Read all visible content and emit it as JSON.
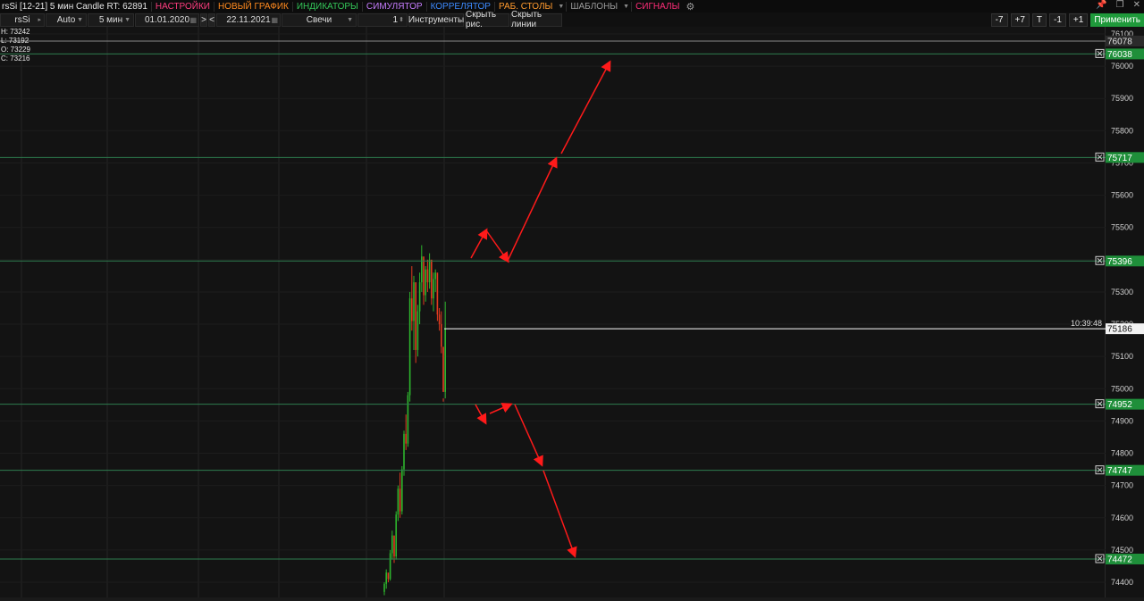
{
  "menubar": {
    "title": "rsSi [12-21] 5 мин Candle RT: 62891",
    "items": [
      {
        "label": "НАСТРОЙКИ",
        "color": "#ff3d7f"
      },
      {
        "label": "НОВЫЙ ГРАФИК",
        "color": "#ff8a1f"
      },
      {
        "label": "ИНДИКАТОРЫ",
        "color": "#34c759"
      },
      {
        "label": "СИМУЛЯТОР",
        "color": "#c77dff"
      },
      {
        "label": "КОРРЕЛЯТОР",
        "color": "#3d8bff"
      },
      {
        "label": "РАБ. СТОЛЫ",
        "color": "#ff9a2e"
      },
      {
        "label": "ШАБЛОНЫ",
        "color": "#9a9a9a"
      },
      {
        "label": "СИГНАЛЫ",
        "color": "#ff2d78"
      }
    ]
  },
  "toolbar": {
    "symbol": "rsSi",
    "scale": "Auto",
    "timeframe": "5 мин",
    "date_from": "01.01.2020",
    "date_to": "22.11.2021",
    "nav_next": ">",
    "nav_prev": "<",
    "chart_type": "Свечи",
    "count": "1",
    "instruments": "Инструменты",
    "hide_drawings": "Скрыть рис.",
    "hide_lines": "Скрыть линии",
    "btn_m7": "-7",
    "btn_p7": "+7",
    "btn_t": "T",
    "btn_m1": "-1",
    "btn_p1": "+1",
    "apply": "Применить"
  },
  "ohlc": {
    "h": "H: 73242",
    "l": "L: 73192",
    "o": "O: 73229",
    "c": "C: 73216"
  },
  "colors": {
    "level_line": "#2e7d4f",
    "level_badge": "#1f8f3a",
    "current_line": "#ffffff",
    "arrow": "#ff1a1a",
    "candle_up": "#2db52d",
    "candle_down": "#e23b1f",
    "grid": "#242424"
  },
  "chart_data": {
    "type": "candlestick",
    "y_ticks": [
      76100,
      76000,
      75900,
      75800,
      75700,
      75600,
      75500,
      75400,
      75300,
      75200,
      75100,
      75000,
      74900,
      74800,
      74700,
      74600,
      74500,
      74400
    ],
    "ylim": [
      74355,
      76125
    ],
    "levels": [
      {
        "value": 76078,
        "label": "76078",
        "style": "grey"
      },
      {
        "value": 76038,
        "label": "76038",
        "style": "green"
      },
      {
        "value": 75717,
        "label": "75717",
        "style": "green"
      },
      {
        "value": 75396,
        "label": "75396",
        "style": "green"
      },
      {
        "value": 74952,
        "label": "74952",
        "style": "green"
      },
      {
        "value": 74747,
        "label": "74747",
        "style": "green"
      },
      {
        "value": 74472,
        "label": "74472",
        "style": "green"
      }
    ],
    "current_price": {
      "value": 75186,
      "label": "75186",
      "time": "10:39:48"
    },
    "candles": [
      [
        74370,
        74400,
        74360,
        74395
      ],
      [
        74395,
        74440,
        74380,
        74430
      ],
      [
        74430,
        74420,
        74400,
        74410
      ],
      [
        74410,
        74500,
        74405,
        74490
      ],
      [
        74490,
        74560,
        74470,
        74545
      ],
      [
        74545,
        74530,
        74460,
        74480
      ],
      [
        74480,
        74620,
        74470,
        74610
      ],
      [
        74610,
        74700,
        74590,
        74690
      ],
      [
        74690,
        74740,
        74600,
        74620
      ],
      [
        74620,
        74760,
        74610,
        74750
      ],
      [
        74750,
        74870,
        74730,
        74860
      ],
      [
        74860,
        74920,
        74810,
        74830
      ],
      [
        74830,
        74990,
        74820,
        74980
      ],
      [
        74980,
        75300,
        74960,
        75280
      ],
      [
        75280,
        75380,
        75180,
        75210
      ],
      [
        75210,
        75350,
        75120,
        75330
      ],
      [
        75330,
        75230,
        75080,
        75120
      ],
      [
        75120,
        75260,
        75100,
        75240
      ],
      [
        75240,
        75360,
        75200,
        75330
      ],
      [
        75330,
        75445,
        75300,
        75410
      ],
      [
        75410,
        75320,
        75260,
        75290
      ],
      [
        75290,
        75380,
        75270,
        75370
      ],
      [
        75370,
        75400,
        75300,
        75330
      ],
      [
        75330,
        75420,
        75310,
        75400
      ],
      [
        75400,
        75340,
        75260,
        75280
      ],
      [
        75280,
        75360,
        75240,
        75340
      ],
      [
        75340,
        75370,
        75300,
        75360
      ],
      [
        75360,
        75320,
        75210,
        75230
      ],
      [
        75230,
        75250,
        75180,
        75200
      ],
      [
        75200,
        75240,
        75110,
        75130
      ],
      [
        75130,
        74970,
        74960,
        74990
      ],
      [
        74990,
        75270,
        74970,
        75186
      ]
    ]
  }
}
